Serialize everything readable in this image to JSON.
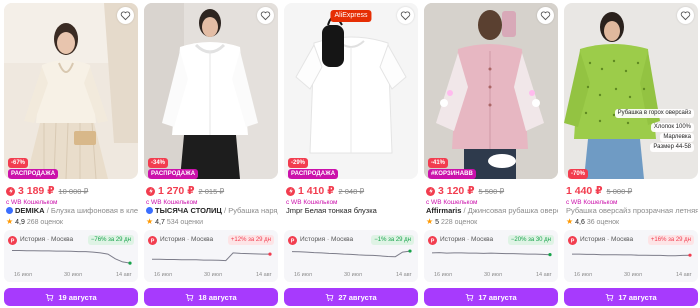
{
  "colors": {
    "price": "#f23d4f",
    "sale_badge": "#cb11ab",
    "button": "#a73afd",
    "rating_star": "#ff9800",
    "history_up": "#f23d4f",
    "history_down": "#17a34a"
  },
  "icons": {
    "favorite": "heart-icon",
    "price_prefix": "lightning-icon",
    "history": "wb-logo-icon",
    "cart": "cart-icon",
    "rating": "star-icon"
  },
  "products": [
    {
      "discount": "-67%",
      "sale_label": "РАСПРОДАЖА",
      "price": "3 189 ₽",
      "old_price": "10 000 ₽",
      "wallet": "с WB Кошельком",
      "brand": "DEMIKA",
      "verified": true,
      "separator": "/",
      "name": "Блузка шифоновая в клетку с",
      "rating": "4,9",
      "reviews": "268 оценок",
      "history_label": "История · Москва",
      "history_change": "−76% за 29 дн",
      "history_direction": "down",
      "history_points": [
        64,
        64,
        63.5,
        63,
        62.5,
        62.5,
        62,
        62,
        61,
        60,
        60,
        58,
        55,
        50,
        32,
        20,
        15
      ],
      "history_dates": [
        "16 июл",
        "30 июл",
        "14 авг"
      ],
      "delivery": "19 августа"
    },
    {
      "discount": "-34%",
      "sale_label": "РАСПРОДАЖА",
      "price": "1 270 ₽",
      "old_price": "2 015 ₽",
      "wallet": "с WB Кошельком",
      "brand": "ТЫСЯЧА СТОЛИЦ",
      "verified": true,
      "separator": "/",
      "name": "Рубашка нарядная белая",
      "rating": "4,7",
      "reviews": "534 оценки",
      "history_label": "История · Москва",
      "history_change": "+12% за 29 дн",
      "history_direction": "up",
      "history_points": [
        30,
        30,
        29,
        29,
        28,
        28,
        28,
        27,
        27,
        26,
        25,
        55,
        53,
        52,
        51,
        50,
        50
      ],
      "history_dates": [
        "16 июл",
        "30 июл",
        "14 авг"
      ],
      "delivery": "18 августа"
    },
    {
      "aliexpress": "AliExpress",
      "discount": "-29%",
      "sale_label": "РАСПРОДАЖА",
      "price": "1 410 ₽",
      "old_price": "2 048 ₽",
      "wallet": "с WB Кошельком",
      "brand": "",
      "verified": false,
      "separator": "",
      "name": "Jmpr Белая тонкая блузка",
      "rating": "",
      "reviews": "",
      "history_label": "История · Москва",
      "history_change": "−1% за 29 дн",
      "history_direction": "down",
      "history_points": [
        60,
        59,
        58,
        56,
        55,
        53,
        52,
        50,
        49,
        47,
        46,
        45,
        43,
        41,
        40,
        58,
        62
      ],
      "history_dates": [
        "16 июл",
        "30 июл",
        "14 авг"
      ],
      "delivery": "27 августа"
    },
    {
      "discount": "-41%",
      "sale_label": "#КОРЗИНАВВ",
      "price": "3 120 ₽",
      "old_price": "5 500 ₽",
      "wallet": "с WB Кошельком",
      "brand": "Affirmaris",
      "verified": false,
      "separator": "/",
      "name": "Джинсовая рубашка оверсайз",
      "rating": "5",
      "reviews": "228 оценок",
      "history_label": "История · Москва",
      "history_change": "−20% за 30 дн",
      "history_direction": "down",
      "history_points": [
        55,
        56,
        54,
        55,
        55,
        54,
        54,
        53,
        54,
        53,
        52,
        52,
        51,
        50,
        50,
        49,
        48
      ],
      "history_dates": [
        "16 июл",
        "30 июл",
        "14 авг"
      ],
      "delivery": "17 августа"
    },
    {
      "discount": "-70%",
      "sale_label": "",
      "price": "1 440 ₽",
      "old_price": "5 000 ₽",
      "wallet": "с WB Кошельком",
      "brand": "",
      "verified": false,
      "separator": "",
      "name": "Рубашка оверсайз прозрачная летняя мар",
      "rating": "4,6",
      "reviews": "36 оценок",
      "overlay_lines": [
        "Рубашка в горох оверсайз",
        "Хлопок 100%",
        "Марлевка",
        "Размер 44-58"
      ],
      "history_label": "История · Москва",
      "history_change": "+16% за 29 дн",
      "history_direction": "up",
      "history_points": [
        50,
        50,
        49,
        49,
        48,
        48,
        48,
        47,
        47,
        46,
        46,
        45,
        45,
        44,
        44,
        45,
        46
      ],
      "history_dates": [
        "16 июл",
        "30 июл",
        "14 авг"
      ],
      "delivery": "17 августа"
    }
  ]
}
